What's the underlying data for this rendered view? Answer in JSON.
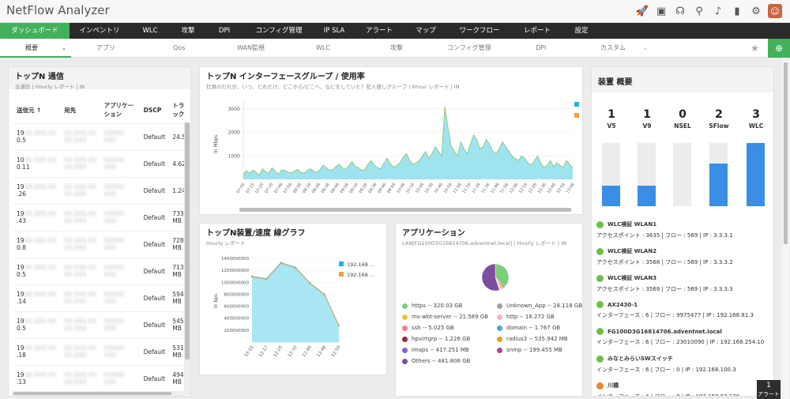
{
  "app": {
    "title": "NetFlow Analyzer"
  },
  "header_icons": [
    "rocket-icon",
    "monitor-icon",
    "headset-icon",
    "search-icon",
    "bell-icon",
    "battery-icon",
    "gear-icon"
  ],
  "main_nav": [
    {
      "label": "ダッシュボード",
      "active": true
    },
    {
      "label": "インベントリ"
    },
    {
      "label": "WLC"
    },
    {
      "label": "攻撃"
    },
    {
      "label": "DPI"
    },
    {
      "label": "コンフィグ管理"
    },
    {
      "label": "IP SLA"
    },
    {
      "label": "アラート"
    },
    {
      "label": "マップ"
    },
    {
      "label": "ワークフロー"
    },
    {
      "label": "レポート"
    },
    {
      "label": "設定"
    }
  ],
  "sub_nav": [
    {
      "label": "概要",
      "active": true
    },
    {
      "label": "アプリ"
    },
    {
      "label": "Qos"
    },
    {
      "label": "WAN監視"
    },
    {
      "label": "WLC"
    },
    {
      "label": "攻撃"
    },
    {
      "label": "コンフィグ管理"
    },
    {
      "label": "DPI"
    },
    {
      "label": "カスタム"
    }
  ],
  "top_comm": {
    "title": "トップN 通信",
    "subtitle": "全通信 | Hourly レポート | IN",
    "columns": [
      "送信元 ↑",
      "宛先",
      "アプリケーション",
      "DSCP",
      "トラック"
    ],
    "rows": [
      {
        "src": "19",
        "src2": "0.5",
        "dscp": "Default",
        "traffic": "24.5"
      },
      {
        "src": "10",
        "src2": "0.11",
        "dscp": "Default",
        "traffic": "4.62"
      },
      {
        "src": "19",
        "src2": ".26",
        "dscp": "Default",
        "traffic": "1.24"
      },
      {
        "src": "19",
        "src2": ".43",
        "dscp": "Default",
        "traffic": "733 MB"
      },
      {
        "src": "19",
        "src2": "0.8",
        "dscp": "Default",
        "traffic": "728 MB"
      },
      {
        "src": "19",
        "src2": "0.5",
        "dscp": "Default",
        "traffic": "713 MB"
      },
      {
        "src": "19",
        "src2": ".14",
        "dscp": "Default",
        "traffic": "594 MB"
      },
      {
        "src": "19",
        "src2": "0.5",
        "dscp": "Default",
        "traffic": "545 MB"
      },
      {
        "src": "19",
        "src2": ".18",
        "dscp": "Default",
        "traffic": "531 MB"
      },
      {
        "src": "19",
        "src2": ".13",
        "dscp": "Default",
        "traffic": "494 MB"
      }
    ]
  },
  "iface_group": {
    "title": "トップN インターフェースグループ / 使用率",
    "subtitle": "社員のだれが、いつ、どれだけ、どこから/どこへ、なにをしていた？犯人捜しグループ | 6hour レポート | IN",
    "ylabel": "in Mbps",
    "colors": {
      "area": "#9ee3ee",
      "line": "#8fbf6a",
      "legend1": "#1aa3d6",
      "legend2": "#f0a040"
    }
  },
  "device_speed": {
    "title": "トップN装置/速度 線グラフ",
    "subtitle": "Hourly レポート",
    "ylabel": "in bps",
    "legend": [
      "192.168 ...",
      "192.168 ..."
    ]
  },
  "applications": {
    "title": "アプリケーション",
    "subtitle": "LAN[FG100D3G16814706.adventnet.local] | Hourly レポート | IN",
    "items": [
      {
        "label": "https -- 320.03 GB",
        "color": "#7ccf7a"
      },
      {
        "label": "Unknown_App -- 28.118 GB",
        "color": "#a0a0a0"
      },
      {
        "label": "ms-wbt-server -- 21.589 GB",
        "color": "#f1c232"
      },
      {
        "label": "http -- 16.272 GB",
        "color": "#f4b6c2"
      },
      {
        "label": "ssh -- 5.025 GB",
        "color": "#f08080"
      },
      {
        "label": "domain -- 1.767 GB",
        "color": "#4aa3df"
      },
      {
        "label": "hpvirtgrp -- 1.226 GB",
        "color": "#a0283a"
      },
      {
        "label": "radius3 -- 535.942 MB",
        "color": "#e6a020"
      },
      {
        "label": "imaps -- 417.251 MB",
        "color": "#8e5fc9"
      },
      {
        "label": "snmp -- 199.455 MB",
        "color": "#b040a0"
      },
      {
        "label": "Others -- 481.806 GB",
        "color": "#7b4fa0"
      }
    ]
  },
  "device_summary": {
    "title": "装置 概要",
    "stats": [
      {
        "value": "1",
        "label": "V5",
        "fill": 0.33
      },
      {
        "value": "1",
        "label": "V9",
        "fill": 0.33
      },
      {
        "value": "0",
        "label": "NSEL",
        "fill": 0
      },
      {
        "value": "2",
        "label": "SFlow",
        "fill": 0.67
      },
      {
        "value": "3",
        "label": "WLC",
        "fill": 1.0
      }
    ],
    "devices": [
      {
        "name": "WLC検証 WLAN1",
        "detail": "アクセスポイント : 3635 | フロー : 569 | IP : 3.3.3.1"
      },
      {
        "name": "WLC検証 WLAN2",
        "detail": "アクセスポイント : 3568 | フロー : 569 | IP : 3.3.3.2"
      },
      {
        "name": "WLC検証 WLAN3",
        "detail": "アクセスポイント : 3569 | フロー : 569 | IP : 3.3.3.3"
      },
      {
        "name": "AX2430-1",
        "detail": "インターフェース : 6 | フロー : 9975477 | IP : 192.168.81.3"
      },
      {
        "name": "FG100D3G16814706.adventnet.local",
        "detail": "インターフェース : 6 | フロー : 23010090 | IP : 192.168.254.10"
      },
      {
        "name": "みなとみらいSWスイッチ",
        "detail": "インターフェース : 6 | フロー : 0 | IP : 192.168.100.3"
      },
      {
        "name": "川橋",
        "detail": "インターフェース : 4 | フロー : 0 | IP : 192.168.82.178"
      }
    ]
  },
  "mini_window": {
    "count": "1",
    "label": "アラート"
  },
  "chart_data": [
    {
      "type": "area",
      "title": "トップN インターフェースグループ / 使用率",
      "ylabel": "in Mbps",
      "ylim": [
        0,
        3300
      ],
      "yticks": [
        1000,
        2000,
        3000
      ],
      "xticks": [
        "07:05",
        "07:15",
        "07:25",
        "07:35",
        "07:46",
        "07:56",
        "08:06",
        "08:16",
        "08:26",
        "08:36",
        "08:46",
        "09:06",
        "09:16",
        "09:26",
        "09:36",
        "09:46",
        "09:56",
        "10:06",
        "10:16",
        "10:26",
        "10:36",
        "10:46",
        "10:56",
        "11:06",
        "11:16",
        "11:26",
        "11:36",
        "11:46",
        "11:56",
        "12:06",
        "12:16",
        "12:26",
        "12:36",
        "12:46",
        "12:56",
        "13:06"
      ],
      "values": [
        200,
        380,
        250,
        400,
        300,
        180,
        450,
        320,
        260,
        500,
        350,
        220,
        400,
        380,
        300,
        280,
        350,
        420,
        300,
        260,
        380,
        450,
        350,
        300,
        420,
        600,
        500,
        380,
        420,
        550,
        650,
        480,
        420,
        600,
        750,
        550,
        500,
        380,
        420,
        650,
        800,
        600,
        500,
        450,
        700,
        900,
        650,
        520,
        600,
        700,
        950,
        1100,
        800,
        650,
        700,
        800,
        1000,
        1200,
        900,
        1100,
        1400,
        1200,
        1000,
        3100,
        2200,
        1400,
        1200,
        1000,
        1600,
        1300,
        1100,
        1500,
        1900,
        1700,
        1300,
        1400,
        1700,
        1500,
        1200,
        1100,
        1300,
        1600,
        1400,
        1200,
        1000,
        900,
        800,
        1000,
        900,
        700,
        600,
        800,
        1000,
        700,
        500,
        600,
        800,
        550,
        700,
        600,
        500,
        800,
        650,
        500
      ]
    },
    {
      "type": "area",
      "title": "トップN装置/速度 線グラフ",
      "ylabel": "in bps",
      "ylim": [
        0,
        1400000000
      ],
      "yticks": [
        200000000,
        400000000,
        600000000,
        800000000,
        1000000000,
        1200000000,
        1400000000
      ],
      "categories": [
        "12:10",
        "12:17",
        "12:25",
        "12:32",
        "12:40",
        "12:48",
        "12:55"
      ],
      "series": [
        {
          "name": "192.168 ...",
          "values": [
            1100000000,
            1060000000,
            1330000000,
            1250000000,
            990000000,
            800000000,
            280000000
          ]
        },
        {
          "name": "192.168 ...",
          "values": [
            1090000000,
            1050000000,
            1320000000,
            1240000000,
            985000000,
            790000000,
            275000000
          ]
        }
      ]
    },
    {
      "type": "pie",
      "title": "アプリケーション",
      "categories": [
        "https",
        "Unknown_App",
        "ms-wbt-server",
        "http",
        "ssh",
        "domain",
        "hpvirtgrp",
        "radius3",
        "imaps",
        "snmp",
        "Others"
      ],
      "values": [
        320.03,
        28.118,
        21.589,
        16.272,
        5.025,
        1.767,
        1.226,
        0.536,
        0.417,
        0.199,
        481.806
      ]
    }
  ]
}
